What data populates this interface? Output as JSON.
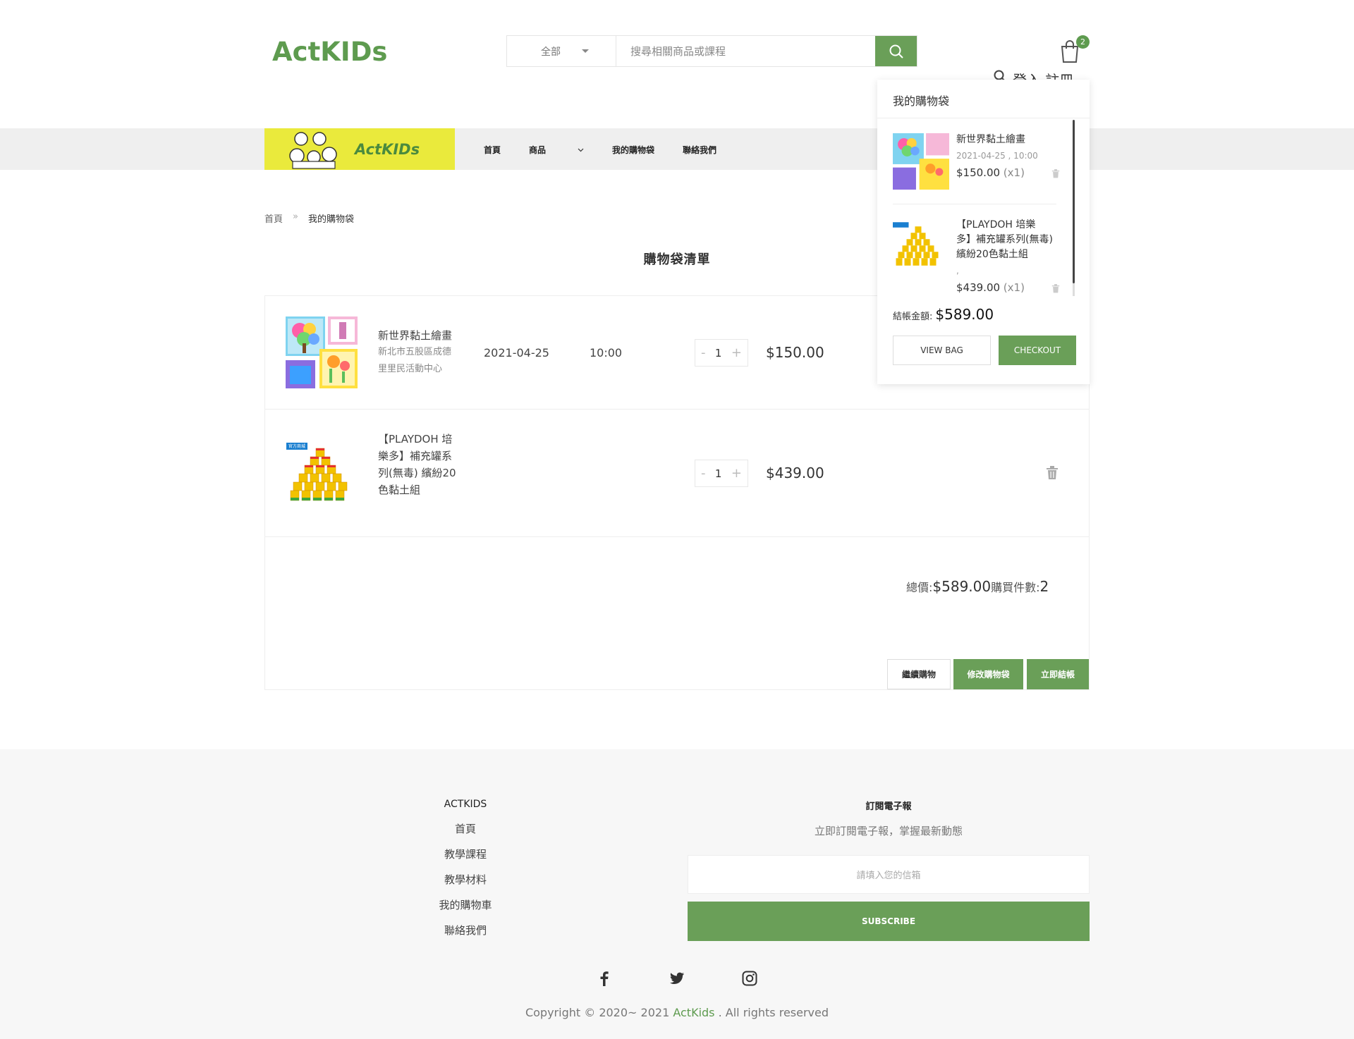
{
  "header": {
    "logo": "ActKIDs",
    "search_category": "全部",
    "search_placeholder": "搜尋相關商品或課程",
    "cart_count": "2",
    "login_text": "登入 註冊"
  },
  "nav": {
    "brand": "ActKIDs",
    "items": [
      {
        "label": "首頁"
      },
      {
        "label": "商品"
      },
      {
        "label": "我的購物袋"
      },
      {
        "label": "聯絡我們"
      }
    ]
  },
  "breadcrumb": {
    "home": "首頁",
    "separator": "»",
    "current": "我的購物袋"
  },
  "page_title": "購物袋清單",
  "cart": {
    "items": [
      {
        "name": "新世界黏土繪畫",
        "location_line1": "新北市五股區成德",
        "location_line2": "里里民活動中心",
        "date": "2021-04-25",
        "time": "10:00",
        "qty": "1",
        "minus": "-",
        "plus": "+",
        "price": "$150.00"
      },
      {
        "name_line1": "【PLAYDOH 培",
        "name_line2": "樂多】補充罐系",
        "name_line3": "列(無毒) 繽紛20",
        "name_line4": "色黏土組",
        "badge": "官方商城",
        "qty": "1",
        "minus": "-",
        "plus": "+",
        "price": "$439.00"
      }
    ],
    "total_label": "總價: ",
    "total_value": "$589.00",
    "count_label": "購買件數: ",
    "count_value": "2",
    "btn_continue": "繼續購物",
    "btn_modify": "修改購物袋",
    "btn_checkout": "立即結帳"
  },
  "mini_cart": {
    "title": "我的購物袋",
    "item1_name": "新世界黏土繪畫",
    "item1_date": "2021-04-25 , 10:00",
    "item1_price": "$150.00",
    "item1_qty": " (x1)",
    "item2_line1": "【PLAYDOH 培樂",
    "item2_line2": "多】補充罐系列(無毒)",
    "item2_line3": "繽紛20色黏土組",
    "item2_dot": ",",
    "item2_price": "$439.00",
    "item2_qty": " (x1)",
    "total_label": "結帳金額:",
    "total_value": "$589.00",
    "btn_view": "VIEW BAG",
    "btn_checkout": "CHECKOUT"
  },
  "footer": {
    "col1_title": "ACTKIDS",
    "links": [
      "首頁",
      "教學課程",
      "教學材料",
      "我的購物車",
      "聯絡我們"
    ],
    "col2_title": "訂閱電子報",
    "col2_sub": "立即訂閱電子報，掌握最新動態",
    "email_placeholder": "請填入您的信箱",
    "subscribe": "SUBSCRIBE",
    "copyright_pre": "Copyright © 2020~ 2021 ",
    "copyright_brand": "ActKids",
    "copyright_post": " . All rights reserved"
  },
  "colors": {
    "accent": "#6a9f58",
    "brand": "#5e9b4f",
    "nav_logo_bg": "#eaea3c"
  }
}
